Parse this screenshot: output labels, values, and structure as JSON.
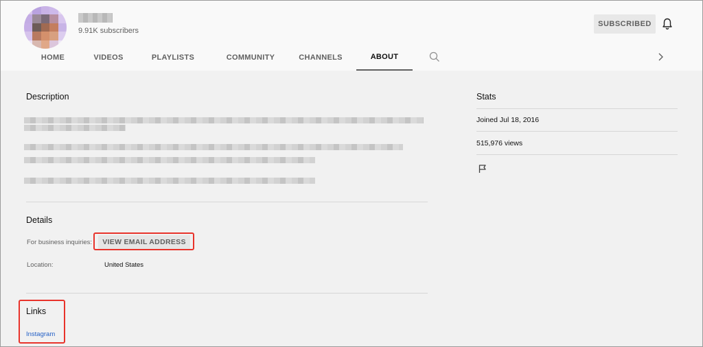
{
  "channel": {
    "subscribers": "9.91K subscribers",
    "subscribe_button": "SUBSCRIBED"
  },
  "tabs": [
    {
      "label": "HOME"
    },
    {
      "label": "VIDEOS"
    },
    {
      "label": "PLAYLISTS"
    },
    {
      "label": "COMMUNITY"
    },
    {
      "label": "CHANNELS"
    },
    {
      "label": "ABOUT",
      "active": true
    }
  ],
  "icons": {
    "tab_search": "search-icon",
    "next": "chevron-right-icon",
    "bell": "bell-icon",
    "report": "flag-icon"
  },
  "description": {
    "title": "Description"
  },
  "details": {
    "title": "Details",
    "business_label": "For business inquiries:",
    "email_button": "VIEW EMAIL ADDRESS",
    "location_label": "Location:",
    "location_value": "United States"
  },
  "links": {
    "title": "Links",
    "items": [
      {
        "label": "Instagram"
      }
    ]
  },
  "stats": {
    "title": "Stats",
    "joined": "Joined Jul 18, 2016",
    "views": "515,976 views"
  },
  "colors": {
    "highlight": "#e8322a",
    "link": "#2460c6",
    "background": "#f1f1f1"
  }
}
